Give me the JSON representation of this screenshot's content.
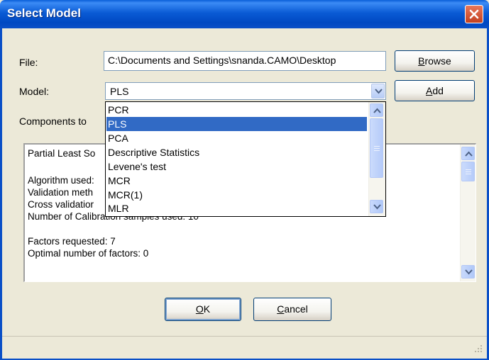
{
  "window": {
    "title": "Select Model"
  },
  "file": {
    "label": "File:",
    "value": "C:\\Documents and Settings\\snanda.CAMO\\Desktop",
    "browse_pre": "",
    "browse_mnemonic": "B",
    "browse_post": "rowse"
  },
  "model": {
    "label": "Model:",
    "value": "PLS",
    "add_pre": "",
    "add_mnemonic": "A",
    "add_post": "dd",
    "options": [
      "PCR",
      "PLS",
      "PCA",
      "Descriptive Statistics",
      "Levene's test",
      "MCR",
      "MCR(1)",
      "MLR"
    ],
    "selected_index": 1
  },
  "components": {
    "label": "Components to"
  },
  "summary": {
    "lines": [
      "Partial Least So",
      "",
      "Algorithm used:",
      "Validation meth",
      "Cross validatior",
      "Number of Calibration samples used: 10",
      "",
      "Factors requested: 7",
      "Optimal number of factors: 0"
    ]
  },
  "buttons": {
    "ok_mnemonic": "O",
    "ok_post": "K",
    "cancel_mnemonic": "C",
    "cancel_post": "ancel"
  },
  "icons": {
    "close": "close-icon",
    "combo_arrow": "chevron-down-icon",
    "scroll_up": "chevron-up-icon",
    "scroll_down": "chevron-down-icon",
    "resize": "resize-grip-icon"
  },
  "colors": {
    "titlebar": "#0A5BD5",
    "close_button": "#C3401E",
    "selection": "#316AC5",
    "dialog_bg": "#ECE9D8"
  }
}
